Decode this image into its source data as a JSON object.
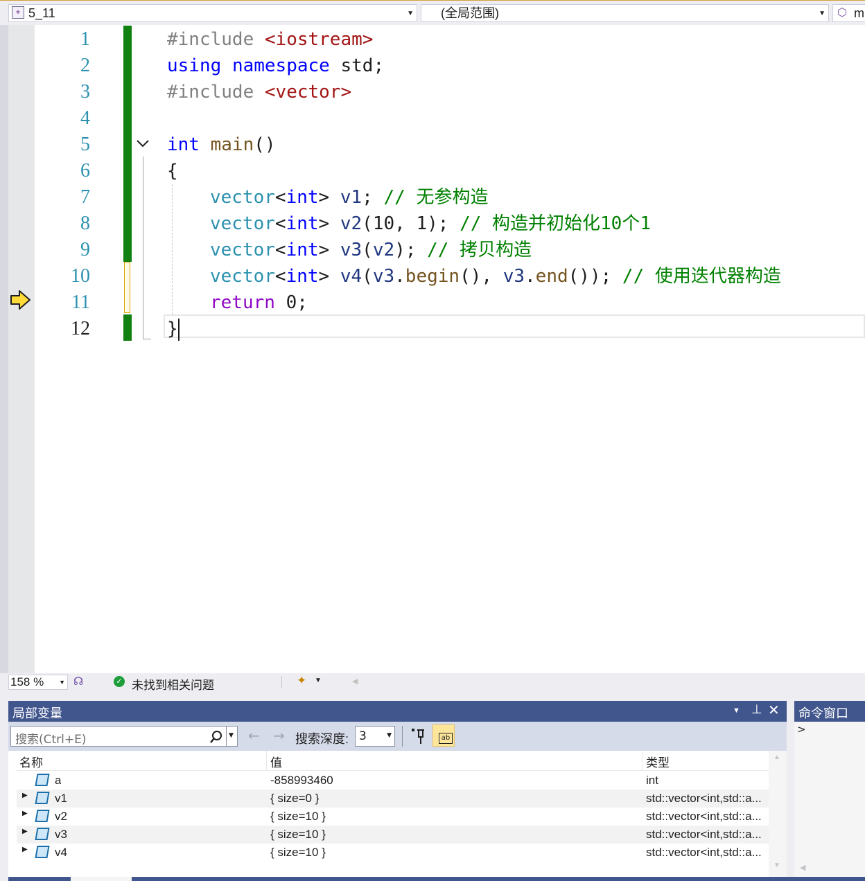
{
  "nav": {
    "project": "5_11",
    "scope": "(全局范围)",
    "member": "m"
  },
  "code_lines": [
    {
      "num": "1"
    },
    {
      "num": "2"
    },
    {
      "num": "3"
    },
    {
      "num": "4"
    },
    {
      "num": "5"
    },
    {
      "num": "6"
    },
    {
      "num": "7"
    },
    {
      "num": "8"
    },
    {
      "num": "9"
    },
    {
      "num": "10"
    },
    {
      "num": "11"
    },
    {
      "num": "12"
    }
  ],
  "code": {
    "l1_directive": "#include",
    "l1_header": "<iostream>",
    "l2_using": "using",
    "l2_namespace": "namespace",
    "l2_rest": " std;",
    "l3_directive": "#include",
    "l3_header": "<vector>",
    "l5_int": "int",
    "l5_main": "main",
    "l5_parens": "()",
    "l6_brace": "{",
    "l7_type": "vector",
    "l7_lt": "<",
    "l7_int": "int",
    "l7_gt": ">",
    "l7_var": "v1",
    "l7_semi": ";",
    "l7_comment": "// 无参构造",
    "l8_type": "vector",
    "l8_lt": "<",
    "l8_int": "int",
    "l8_gt": ">",
    "l8_var": "v2",
    "l8_args": "(10, 1);",
    "l8_comment": "// 构造并初始化10个1",
    "l9_type": "vector",
    "l9_lt": "<",
    "l9_int": "int",
    "l9_gt": ">",
    "l9_var": "v3",
    "l9_open": "(",
    "l9_arg": "v2",
    "l9_close": ");",
    "l9_comment": "// 拷贝构造",
    "l10_type": "vector",
    "l10_lt": "<",
    "l10_int": "int",
    "l10_gt": ">",
    "l10_var": "v4",
    "l10_open": "(",
    "l10_a": "v3",
    "l10_dot1": ".",
    "l10_begin": "begin",
    "l10_mid": "(), ",
    "l10_b": "v3",
    "l10_dot2": ".",
    "l10_end": "end",
    "l10_close": "());",
    "l10_comment": "// 使用迭代器构造",
    "l11_return": "return",
    "l11_rest": " 0;",
    "l12_brace": "}"
  },
  "status": {
    "zoom": "158 %",
    "issues": "未找到相关问题"
  },
  "locals": {
    "title": "局部变量",
    "search_placeholder": "搜索(Ctrl+E)",
    "depth_label": "搜索深度:",
    "depth_value": "3",
    "columns": {
      "name": "名称",
      "value": "值",
      "type": "类型"
    },
    "rows": [
      {
        "name": "a",
        "value": "-858993460",
        "type": "int"
      },
      {
        "name": "v1",
        "value": "{ size=0 }",
        "type": "std::vector<int,std::a..."
      },
      {
        "name": "v2",
        "value": "{ size=10 }",
        "type": "std::vector<int,std::a..."
      },
      {
        "name": "v3",
        "value": "{ size=10 }",
        "type": "std::vector<int,std::a..."
      },
      {
        "name": "v4",
        "value": "{ size=10 }",
        "type": "std::vector<int,std::a..."
      }
    ]
  },
  "command_window": {
    "title": "命令窗口",
    "prompt": ">"
  }
}
